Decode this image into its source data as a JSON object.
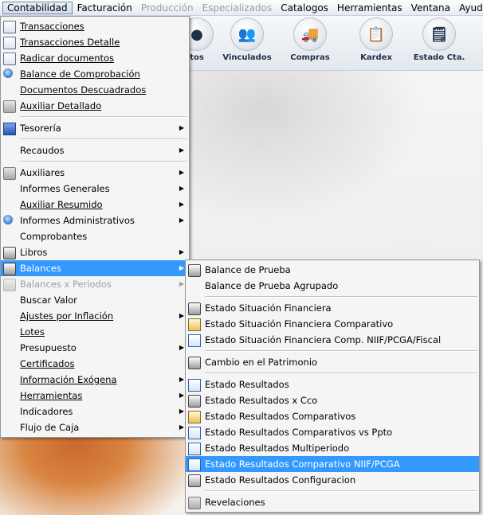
{
  "menubar": [
    "Contabilidad",
    "Facturación",
    "Producción",
    "Especializados",
    "Catalogos",
    "Herramientas",
    "Ventana",
    "Ayuda"
  ],
  "toolbar": [
    "tos",
    "Vinculados",
    "Compras",
    "Kardex",
    "Estado Cta."
  ],
  "menu": {
    "items": [
      {
        "label": "Transacciones",
        "icon": "document-icon"
      },
      {
        "label": "Transacciones Detalle",
        "icon": "document-icon"
      },
      {
        "label": "Radicar documentos",
        "icon": "document-icon"
      },
      {
        "label": "Balance de Comprobación",
        "icon": "magnifier-icon"
      },
      {
        "label": "Documentos Descuadrados",
        "icon": ""
      },
      {
        "label": "Auxiliar Detallado",
        "icon": "report-icon"
      },
      {
        "label": "Tesorería",
        "icon": "tesoreria-icon"
      },
      {
        "label": "Recaudos",
        "icon": ""
      },
      {
        "label": "Auxiliares",
        "icon": "report-icon"
      },
      {
        "label": "Informes Generales",
        "icon": ""
      },
      {
        "label": "Auxiliar Resumido",
        "icon": ""
      },
      {
        "label": "Informes Administrativos",
        "icon": "magnifier-icon"
      },
      {
        "label": "Comprobantes",
        "icon": ""
      },
      {
        "label": "Libros",
        "icon": "printer-icon"
      },
      {
        "label": "Balances",
        "icon": "printer-icon"
      },
      {
        "label": "Balances x Periodos",
        "icon": "printer-icon"
      },
      {
        "label": "Buscar Valor",
        "icon": ""
      },
      {
        "label": "Ajustes por Inflación",
        "icon": ""
      },
      {
        "label": "Lotes",
        "icon": ""
      },
      {
        "label": "Presupuesto",
        "icon": ""
      },
      {
        "label": "Certificados",
        "icon": ""
      },
      {
        "label": "Información Exógena",
        "icon": ""
      },
      {
        "label": "Herramientas",
        "icon": ""
      },
      {
        "label": "Indicadores",
        "icon": ""
      },
      {
        "label": "Flujo de Caja",
        "icon": ""
      }
    ]
  },
  "submenu": {
    "items": [
      {
        "label": "Balance de Prueba",
        "icon": "printer-icon"
      },
      {
        "label": "Balance de Prueba Agrupado",
        "icon": ""
      },
      {
        "label": "Estado Situación Financiera",
        "icon": "printer-icon"
      },
      {
        "label": "Estado Situación Financiera Comparativo",
        "icon": "compare-icon"
      },
      {
        "label": "Estado Situación Financiera Comp. NIIF/PCGA/Fiscal",
        "icon": "chart-icon"
      },
      {
        "label": "Cambio en el Patrimonio",
        "icon": "printer-icon"
      },
      {
        "label": "Estado Resultados",
        "icon": "table-icon"
      },
      {
        "label": "Estado Resultados x Cco",
        "icon": "printer-icon"
      },
      {
        "label": "Estado Resultados Comparativos",
        "icon": "compare-icon"
      },
      {
        "label": "Estado Resultados Comparativos vs Ppto",
        "icon": "chart-icon"
      },
      {
        "label": "Estado Resultados Multiperiodo",
        "icon": "chart-icon"
      },
      {
        "label": "Estado Resultados Comparativo NIIF/PCGA",
        "icon": "chart-icon"
      },
      {
        "label": "Estado Resultados Configuracion",
        "icon": "printer-icon"
      },
      {
        "label": "Revelaciones",
        "icon": "report-icon"
      }
    ]
  }
}
